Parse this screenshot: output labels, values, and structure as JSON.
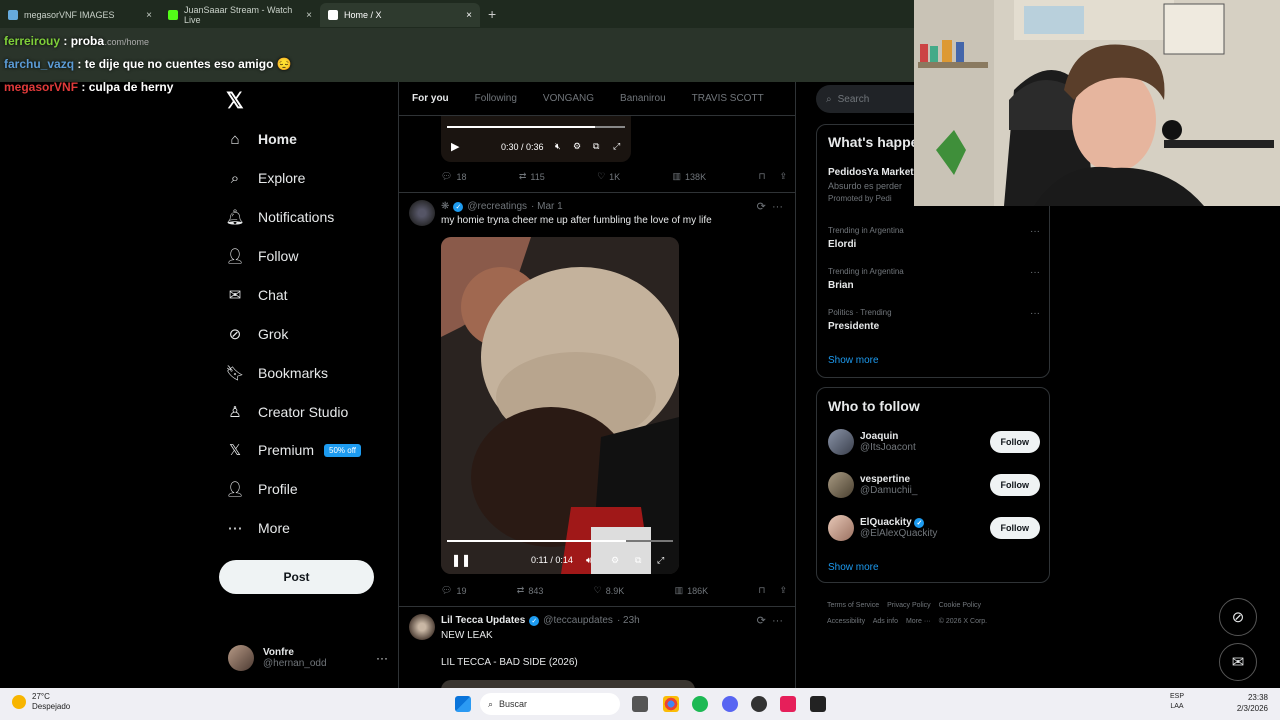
{
  "browser": {
    "tabs": [
      {
        "label": "megasorVNF IMAGES",
        "close": "×"
      },
      {
        "label": "JuanSaaar Stream - Watch Live",
        "close": "×"
      },
      {
        "label": "Home / X",
        "close": "×"
      }
    ],
    "new_tab": "+",
    "address": "x.com/home"
  },
  "chat": [
    {
      "user": "ferreirouy",
      "sep": " : ",
      "message": "proba"
    },
    {
      "user": "farchu_vazq",
      "sep": " : ",
      "message": "te dije que no cuentes eso amigo 😔"
    },
    {
      "user": "megasorVNF",
      "sep": " : ",
      "message": "culpa de herny"
    }
  ],
  "sidebar": {
    "logo": "𝕏",
    "items": [
      {
        "label": "Home",
        "icon": "home-icon",
        "glyph": "⌂"
      },
      {
        "label": "Explore",
        "icon": "search-icon",
        "glyph": "⌕"
      },
      {
        "label": "Notifications",
        "icon": "bell-icon",
        "glyph": "🔔︎"
      },
      {
        "label": "Follow",
        "icon": "person-add-icon",
        "glyph": "👤︎"
      },
      {
        "label": "Chat",
        "icon": "mail-icon",
        "glyph": "✉"
      },
      {
        "label": "Grok",
        "icon": "grok-icon",
        "glyph": "⊘"
      },
      {
        "label": "Bookmarks",
        "icon": "bookmark-icon",
        "glyph": "🔖︎"
      },
      {
        "label": "Creator Studio",
        "icon": "creator-icon",
        "glyph": "♙"
      },
      {
        "label": "Premium",
        "icon": "x-icon",
        "glyph": "𝕏",
        "badge": "50% off"
      },
      {
        "label": "Profile",
        "icon": "profile-icon",
        "glyph": "👤︎"
      },
      {
        "label": "More",
        "icon": "more-icon",
        "glyph": "⋯"
      }
    ],
    "post_button": "Post",
    "account": {
      "name": "Vonfre",
      "handle": "@hernan_odd",
      "more": "···"
    }
  },
  "timeline": {
    "tabs": [
      "For you",
      "Following",
      "VONGANG",
      "Bananirou",
      "TRAVIS SCOTT"
    ],
    "tweet1": {
      "video_time": "0:30 / 0:36",
      "video_progress": 0.83,
      "actions": {
        "replies": "18",
        "reposts": "115",
        "likes": "1K",
        "views": "138K"
      }
    },
    "tweet2": {
      "handle": "@recreatings",
      "date": "· Mar 1",
      "text": "my homie tryna cheer me up after fumbling the love of my life",
      "video_time": "0:11 / 0:14",
      "video_progress": 0.79,
      "actions": {
        "replies": "19",
        "reposts": "843",
        "likes": "8.9K",
        "views": "186K"
      }
    },
    "tweet3": {
      "name": "Lil Tecca Updates",
      "handle": "@teccaupdates",
      "date": "· 23h",
      "line1": "NEW LEAK",
      "line2": "LIL TECCA - BAD SIDE (2026)"
    }
  },
  "right": {
    "search_placeholder": "Search",
    "trending_title": "What's happening",
    "promo": {
      "title": "PedidosYa Market",
      "subtitle": "Absurdo es perder",
      "promoted": "Promoted by Pedi"
    },
    "trends": [
      {
        "meta": "Trending in Argentina",
        "topic": "Elordi"
      },
      {
        "meta": "Trending in Argentina",
        "topic": "Brian"
      },
      {
        "meta": "Politics · Trending",
        "topic": "Presidente"
      }
    ],
    "show_more": "Show more",
    "who_title": "Who to follow",
    "who": [
      {
        "name": "Joaquin",
        "handle": "@ItsJoacont",
        "button": "Follow"
      },
      {
        "name": "vespertine",
        "handle": "@Damuchii_",
        "button": "Follow"
      },
      {
        "name": "ElQuackity",
        "handle": "@ElAlexQuackity",
        "button": "Follow"
      }
    ],
    "who_show_more": "Show more",
    "footer": [
      "Terms of Service",
      "Privacy Policy",
      "Cookie Policy",
      "Accessibility",
      "Ads info",
      "More ···",
      "© 2026 X Corp."
    ]
  },
  "taskbar": {
    "temp": "27°C",
    "weather": "Despejado",
    "search": "Buscar",
    "lang1": "ESP",
    "lang2": "LAA",
    "time": "23:38",
    "date": "2/3/2026"
  }
}
